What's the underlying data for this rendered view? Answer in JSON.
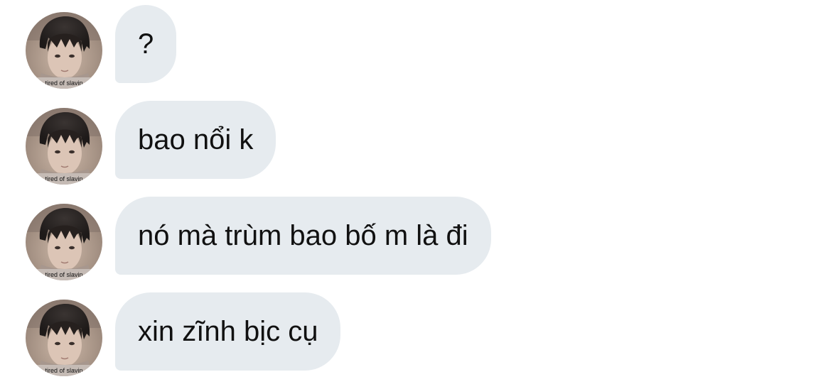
{
  "colors": {
    "bubble_background": "#e6ebef",
    "message_text": "#111111",
    "page_background": "#ffffff"
  },
  "messages": [
    {
      "text": "?",
      "avatar_caption": "tired of slavin"
    },
    {
      "text": "bao nổi k",
      "avatar_caption": "tired of slavin"
    },
    {
      "text": "nó mà trùm bao bố m là đi",
      "avatar_caption": "tired of slavin"
    },
    {
      "text": "xin zĩnh bịc cụ",
      "avatar_caption": "tired of slavin"
    }
  ]
}
